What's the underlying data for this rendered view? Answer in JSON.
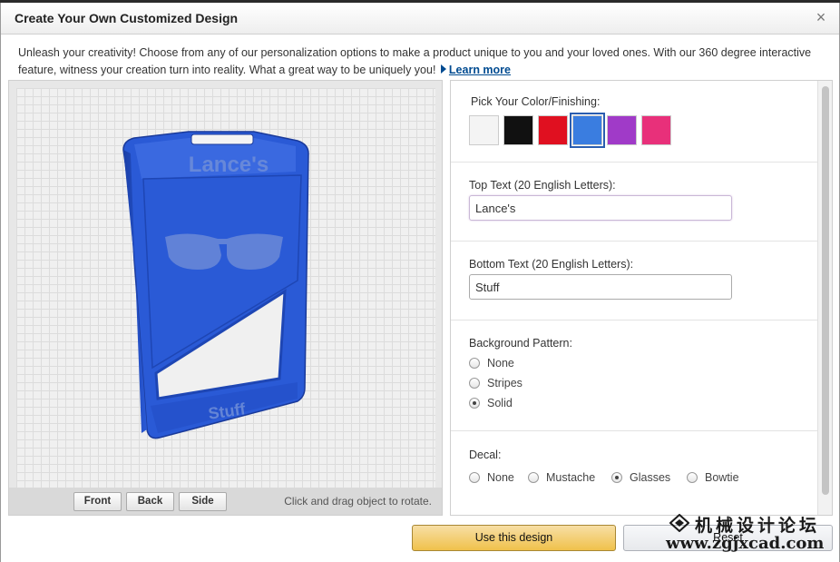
{
  "dialog": {
    "title": "Create Your Own Customized Design",
    "close_symbol": "×",
    "intro_text": "Unleash your creativity! Choose from any of our personalization options to make a product unique to you and your loved ones. With our 360 degree interactive feature, witness your creation turn into reality. What a great way to be uniquely you!",
    "learn_more": "Learn more"
  },
  "viewer": {
    "model_top_text": "Lance's",
    "model_bottom_text": "Stuff",
    "model_color": "#2a5ad6",
    "buttons": {
      "front": "Front",
      "back": "Back",
      "side": "Side"
    },
    "hint": "Click and drag object to rotate."
  },
  "options": {
    "color": {
      "label": "Pick Your Color/Finishing:",
      "swatches": [
        {
          "name": "white",
          "color": "#f4f4f4"
        },
        {
          "name": "black",
          "color": "#111111"
        },
        {
          "name": "red",
          "color": "#e01020"
        },
        {
          "name": "blue",
          "color": "#3a7de0"
        },
        {
          "name": "purple",
          "color": "#a03ac8"
        },
        {
          "name": "pink",
          "color": "#e8307a"
        }
      ],
      "selected": "blue"
    },
    "top_text": {
      "label": "Top Text (20 English Letters):",
      "value": "Lance's"
    },
    "bottom_text": {
      "label": "Bottom Text (20 English Letters):",
      "value": "Stuff"
    },
    "background_pattern": {
      "label": "Background Pattern:",
      "choices": [
        "None",
        "Stripes",
        "Solid"
      ],
      "selected": "Solid"
    },
    "decal": {
      "label": "Decal:",
      "choices": [
        "None",
        "Mustache",
        "Glasses",
        "Bowtie"
      ],
      "selected": "Glasses"
    }
  },
  "actions": {
    "use_design": "Use this design",
    "reset": "Reset"
  },
  "watermark": {
    "chinese": "机械设计论坛",
    "url": "www.zgjxcad.com"
  }
}
